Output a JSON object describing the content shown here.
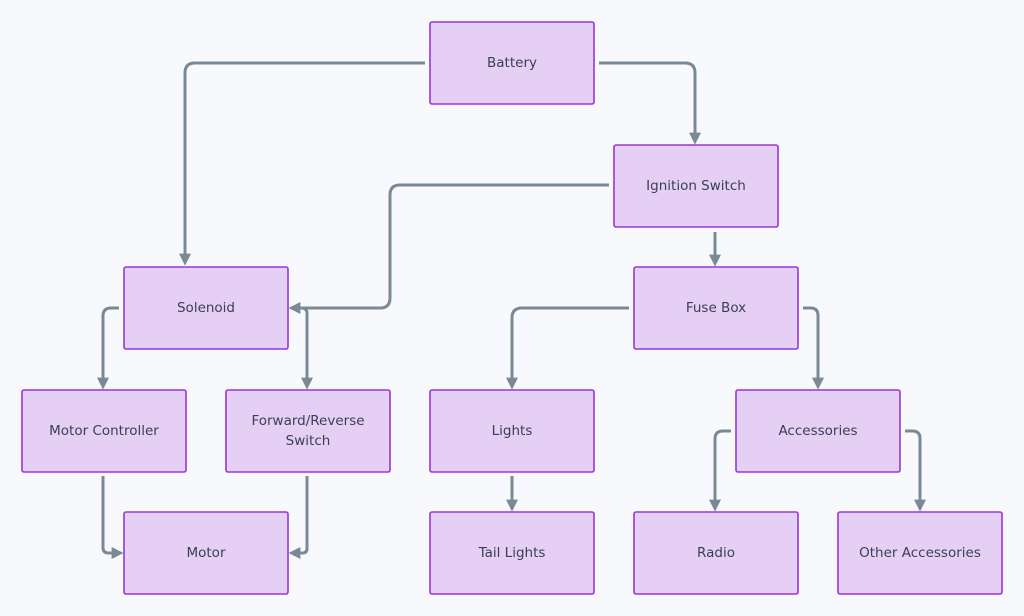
{
  "colors": {
    "node_fill": "#e5cff4",
    "node_border": "#9a35d6",
    "edge": "#7a8996",
    "background": "#f8f9fc"
  },
  "nodes": [
    {
      "id": "battery",
      "label": [
        "Battery"
      ]
    },
    {
      "id": "ignition",
      "label": [
        "Ignition Switch"
      ]
    },
    {
      "id": "solenoid",
      "label": [
        "Solenoid"
      ]
    },
    {
      "id": "fuse",
      "label": [
        "Fuse Box"
      ]
    },
    {
      "id": "motorctrl",
      "label": [
        "Motor Controller"
      ]
    },
    {
      "id": "fwdrev",
      "label": [
        "Forward/Reverse",
        "Switch"
      ]
    },
    {
      "id": "lights",
      "label": [
        "Lights"
      ]
    },
    {
      "id": "accessories",
      "label": [
        "Accessories"
      ]
    },
    {
      "id": "motor",
      "label": [
        "Motor"
      ]
    },
    {
      "id": "tail",
      "label": [
        "Tail Lights"
      ]
    },
    {
      "id": "radio",
      "label": [
        "Radio"
      ]
    },
    {
      "id": "other",
      "label": [
        "Other Accessories"
      ]
    }
  ],
  "edges": [
    {
      "from": "battery",
      "to": "solenoid"
    },
    {
      "from": "battery",
      "to": "ignition"
    },
    {
      "from": "ignition",
      "to": "solenoid"
    },
    {
      "from": "ignition",
      "to": "fuse"
    },
    {
      "from": "solenoid",
      "to": "motorctrl"
    },
    {
      "from": "solenoid",
      "to": "fwdrev"
    },
    {
      "from": "fuse",
      "to": "lights"
    },
    {
      "from": "fuse",
      "to": "accessories"
    },
    {
      "from": "motorctrl",
      "to": "motor"
    },
    {
      "from": "fwdrev",
      "to": "motor"
    },
    {
      "from": "lights",
      "to": "tail"
    },
    {
      "from": "accessories",
      "to": "radio"
    },
    {
      "from": "accessories",
      "to": "other"
    }
  ]
}
